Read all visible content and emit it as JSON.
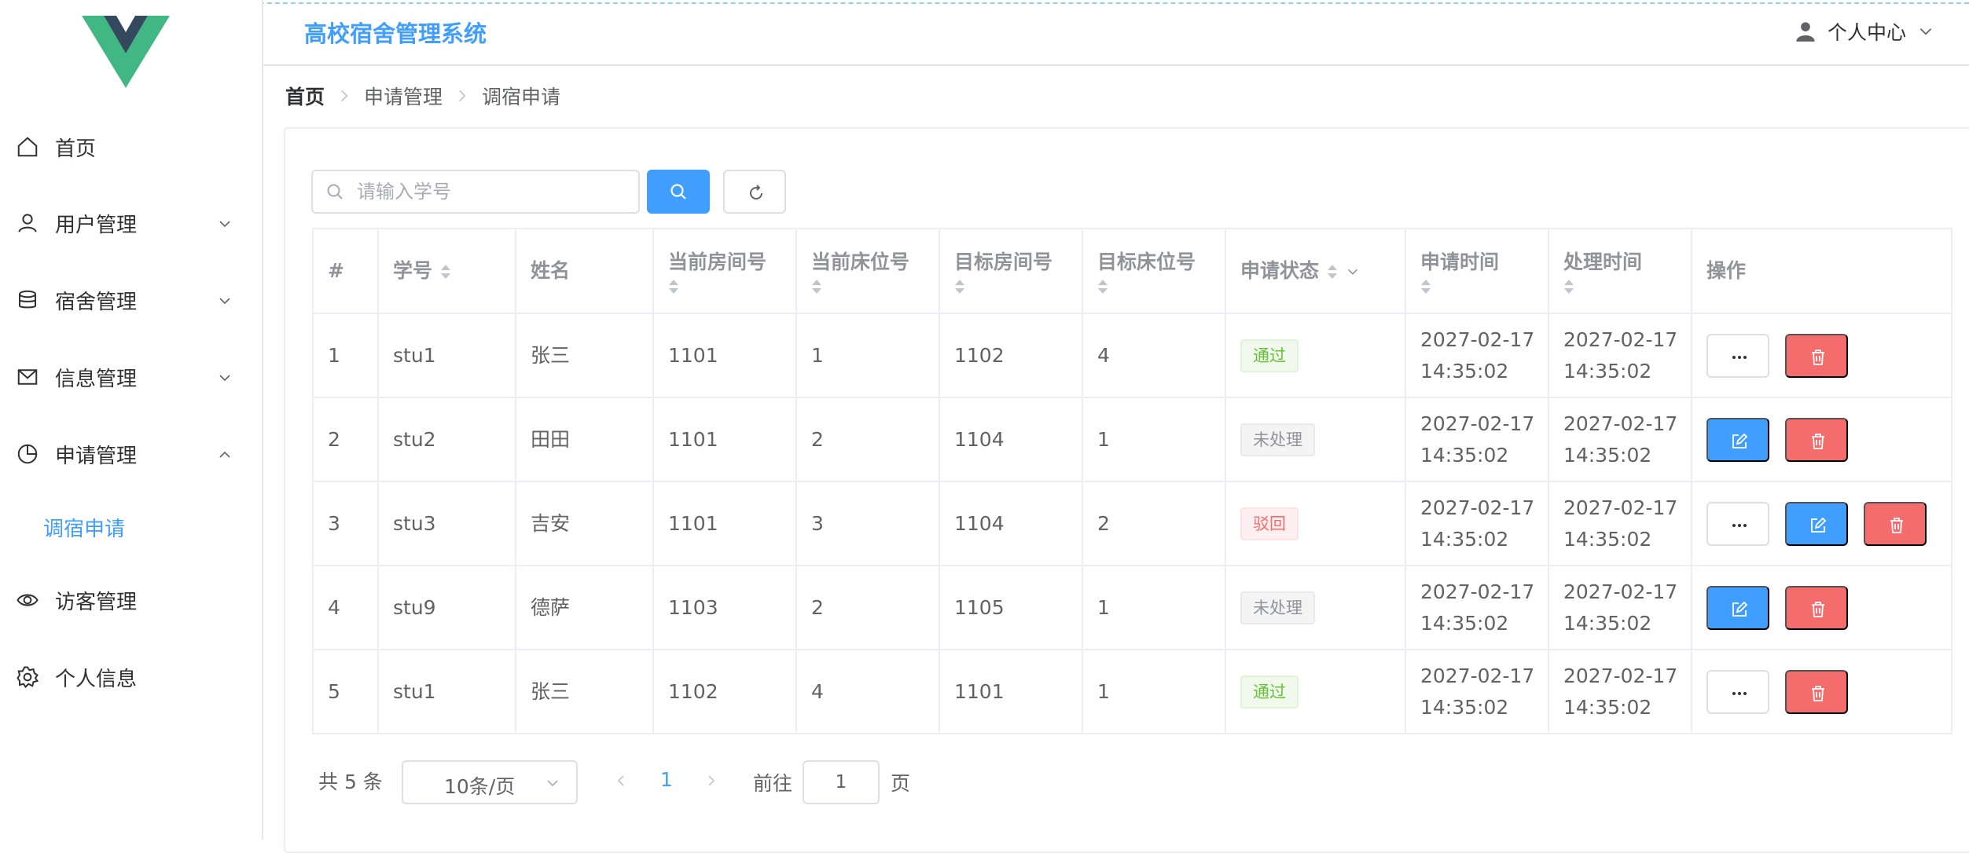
{
  "app": {
    "title": "高校宿舍管理系统",
    "user_menu": "个人中心"
  },
  "colors": {
    "primary": "#409eff",
    "danger": "#f56c6c",
    "success": "#67c23a"
  },
  "sidebar": {
    "items": [
      {
        "label": "首页",
        "icon": "home-icon"
      },
      {
        "label": "用户管理",
        "icon": "user-icon"
      },
      {
        "label": "宿舍管理",
        "icon": "database-icon"
      },
      {
        "label": "信息管理",
        "icon": "message-icon"
      },
      {
        "label": "申请管理",
        "icon": "pie-chart-icon"
      },
      {
        "label": "访客管理",
        "icon": "eye-icon"
      },
      {
        "label": "个人信息",
        "icon": "gear-icon"
      }
    ],
    "submenu": {
      "label": "调宿申请"
    }
  },
  "breadcrumb": {
    "home": "首页",
    "parent": "申请管理",
    "current": "调宿申请"
  },
  "search": {
    "placeholder": "请输入学号"
  },
  "table": {
    "headers": [
      "#",
      "学号",
      "姓名",
      "当前房间号",
      "当前床位号",
      "目标房间号",
      "目标床位号",
      "申请状态",
      "申请时间",
      "处理时间",
      "操作"
    ],
    "rows": [
      {
        "idx": "1",
        "sid": "stu1",
        "name": "张三",
        "cur_room": "1101",
        "cur_bed": "1",
        "tgt_room": "1102",
        "tgt_bed": "4",
        "status": "通过",
        "apply_date": "2027-02-17",
        "apply_time": "14:35:02",
        "proc_date": "2027-02-17",
        "proc_time": "14:35:02"
      },
      {
        "idx": "2",
        "sid": "stu2",
        "name": "田田",
        "cur_room": "1101",
        "cur_bed": "2",
        "tgt_room": "1104",
        "tgt_bed": "1",
        "status": "未处理",
        "apply_date": "2027-02-17",
        "apply_time": "14:35:02",
        "proc_date": "2027-02-17",
        "proc_time": "14:35:02"
      },
      {
        "idx": "3",
        "sid": "stu3",
        "name": "吉安",
        "cur_room": "1101",
        "cur_bed": "3",
        "tgt_room": "1104",
        "tgt_bed": "2",
        "status": "驳回",
        "apply_date": "2027-02-17",
        "apply_time": "14:35:02",
        "proc_date": "2027-02-17",
        "proc_time": "14:35:02"
      },
      {
        "idx": "4",
        "sid": "stu9",
        "name": "德萨",
        "cur_room": "1103",
        "cur_bed": "2",
        "tgt_room": "1105",
        "tgt_bed": "1",
        "status": "未处理",
        "apply_date": "2027-02-17",
        "apply_time": "14:35:02",
        "proc_date": "2027-02-17",
        "proc_time": "14:35:02"
      },
      {
        "idx": "5",
        "sid": "stu1",
        "name": "张三",
        "cur_room": "1102",
        "cur_bed": "4",
        "tgt_room": "1101",
        "tgt_bed": "1",
        "status": "通过",
        "apply_date": "2027-02-17",
        "apply_time": "14:35:02",
        "proc_date": "2027-02-17",
        "proc_time": "14:35:02"
      }
    ]
  },
  "pagination": {
    "total": "共 5 条",
    "page_size": "10条/页",
    "current": "1",
    "goto_label": "前往",
    "goto_value": "1",
    "goto_unit": "页"
  }
}
